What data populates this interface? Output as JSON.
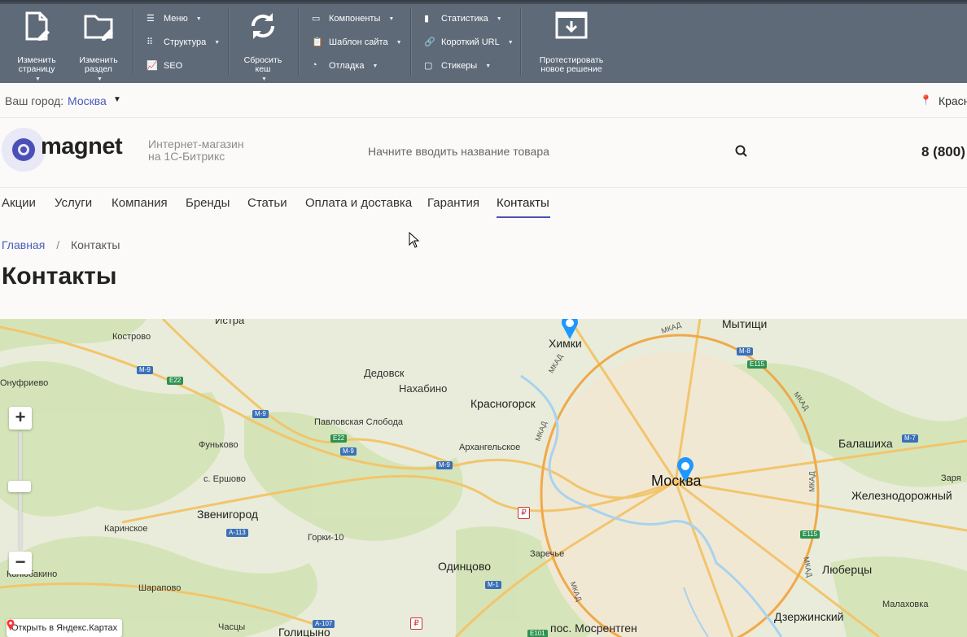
{
  "admin": {
    "big_buttons": [
      {
        "id": "edit-page",
        "label": "Изменить\nстраницу"
      },
      {
        "id": "edit-section",
        "label": "Изменить\nраздел"
      },
      {
        "id": "reset-cache",
        "label": "Сбросить\nкеш"
      },
      {
        "id": "test-solution",
        "label": "Протестировать\nновое решение"
      }
    ],
    "col1": [
      "Меню",
      "Структура",
      "SEO"
    ],
    "col2": [
      "Компоненты",
      "Шаблон сайта",
      "Отладка"
    ],
    "col3": [
      "Статистика",
      "Короткий URL",
      "Стикеры"
    ]
  },
  "citybar": {
    "label": "Ваш город:",
    "city": "Москва",
    "address": "Красн"
  },
  "header": {
    "logo": "magnet",
    "slogan_line1": "Интернет-магазин",
    "slogan_line2": "на 1С-Битрикс",
    "search_placeholder": "Начните вводить название товара",
    "phone": "8 (800)"
  },
  "menu": [
    "Акции",
    "Услуги",
    "Компания",
    "Бренды",
    "Статьи",
    "Оплата и доставка",
    "Гарантия",
    "Контакты"
  ],
  "breadcrumbs": {
    "home": "Главная",
    "sep": "/",
    "current": "Контакты"
  },
  "page_title": "Контакты",
  "map": {
    "open_link": "Открыть в Яндекс.Картах",
    "places": {
      "istra": "Истра",
      "khimki": "Химки",
      "mytishchi": "Мытищи",
      "kostrovo": "Кострово",
      "onufrievo": "Онуфриево",
      "dedovsk": "Дедовск",
      "nakhabino": "Нахабино",
      "krasnogorsk": "Красногорск",
      "pavlovskaya": "Павловская Слобода",
      "fun": "Фуньково",
      "arkh": "Архангельское",
      "balashikha": "Балашиха",
      "ershovo": "с. Ершово",
      "moscow": "Москва",
      "zarya": "Заря",
      "zhel": "Железнодорожный",
      "zvenigorod": "Звенигород",
      "karinskoe": "Каринское",
      "gorki": "Горки-10",
      "zarechye": "Заречье",
      "odintsovo": "Одинцово",
      "lyubertsy": "Люберцы",
      "kolyubakino": "Колюбакино",
      "sharapovo": "Шарапово",
      "dzerzh": "Дзержинский",
      "malakhovka": "Малаховка",
      "chastsy": "Часцы",
      "golitsyno": "Голицыно",
      "mosrentgen": "пос. Мосрентген"
    },
    "shields": [
      "M-9",
      "E22",
      "M-9",
      "M-9",
      "E22",
      "M-9",
      "M-9",
      "M-8",
      "E115",
      "M-7",
      "E115",
      "A-113",
      "M-1",
      "A-107",
      "E101"
    ],
    "mkad": "МКАД"
  }
}
